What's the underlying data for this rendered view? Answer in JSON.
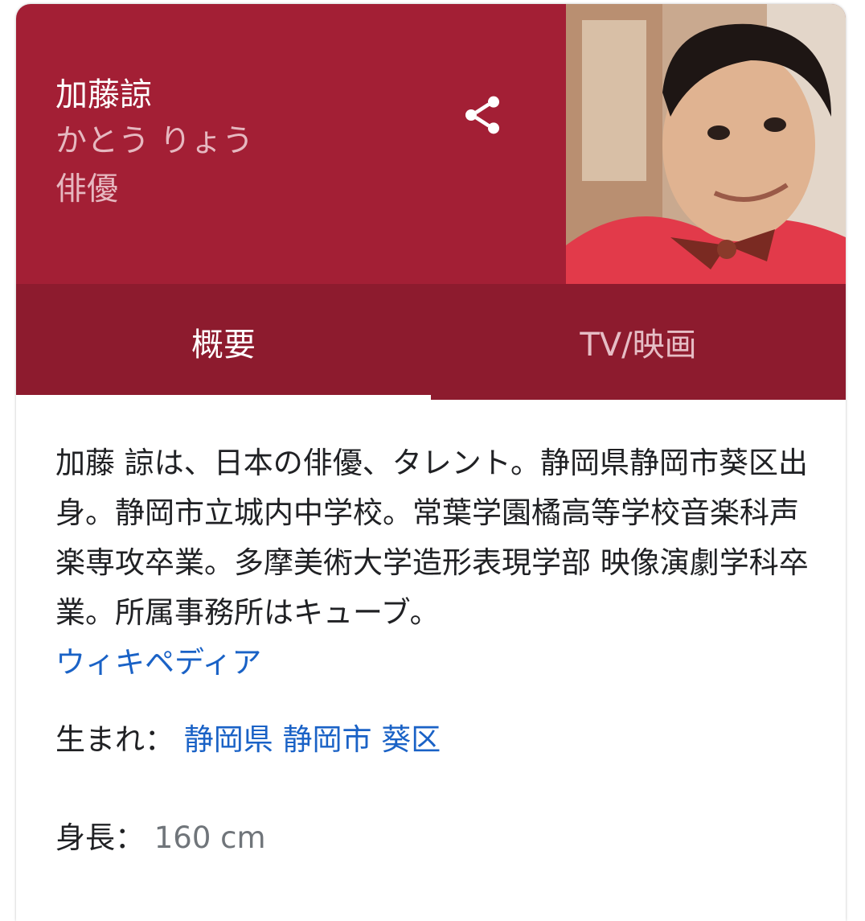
{
  "header": {
    "name": "加藤諒",
    "reading": "かとう りょう",
    "occupation": "俳優",
    "share_icon": "share-icon",
    "background_color": "#a31f35"
  },
  "tabs": [
    {
      "label": "概要",
      "selected": true
    },
    {
      "label": "TV/映画",
      "selected": false
    }
  ],
  "description": {
    "text": "加藤 諒は、日本の俳優、タレント。静岡県静岡市葵区出身。静岡市立城内中学校。常葉学園橘高等学校音楽科声楽専攻卒業。多摩美術大学造形表現学部 映像演劇学科卒業。所属事務所はキューブ。",
    "source_link": "ウィキペディア"
  },
  "facts": {
    "born": {
      "label": "生まれ：",
      "links": [
        "静岡県",
        "静岡市",
        "葵区"
      ]
    },
    "height": {
      "label": "身長：",
      "value": "160 cm"
    }
  }
}
